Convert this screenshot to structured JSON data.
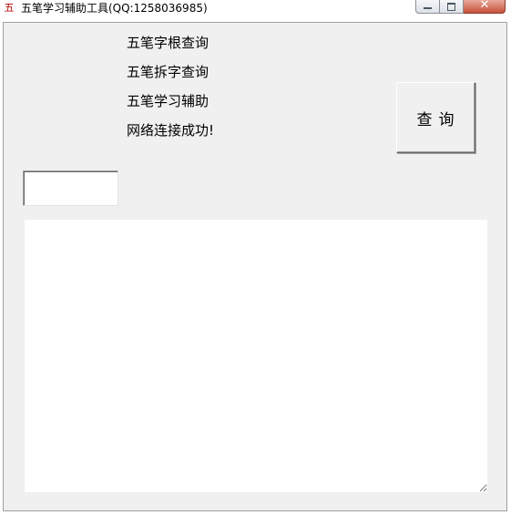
{
  "window": {
    "title": "五笔学习辅助工具(QQ:1258036985)",
    "icon_glyph": "五",
    "controls": {
      "minimize": "minimize-icon",
      "maximize": "maximize-icon",
      "close": "close-icon",
      "close_glyph": "✕"
    }
  },
  "labels": [
    "五笔字根查询",
    "五笔拆字查询",
    "五笔学习辅助",
    "网络连接成功!"
  ],
  "query_button": {
    "label": "查询"
  },
  "input": {
    "value": "",
    "placeholder": ""
  },
  "result_area": {
    "text": ""
  },
  "colors": {
    "client_background": "#f0f0f0",
    "close_button": "#c7513a",
    "app_icon": "#b30000"
  }
}
